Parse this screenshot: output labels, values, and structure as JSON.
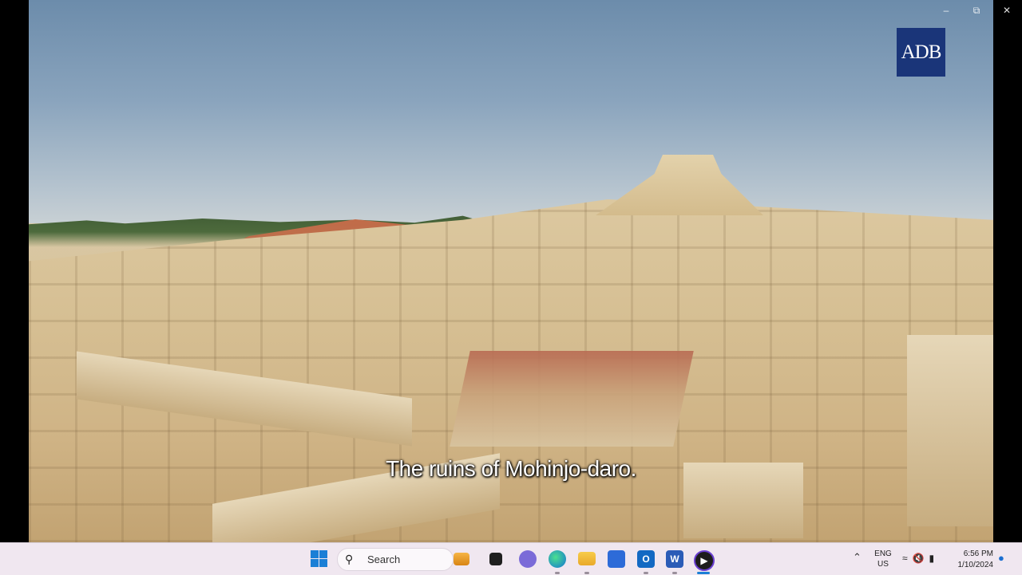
{
  "video": {
    "logo_text": "ADB",
    "caption": "The ruins of Mohinjo-daro."
  },
  "window_controls": {
    "minimize": "–",
    "restore": "⧉",
    "close": "✕"
  },
  "taskbar": {
    "search_label": "Search",
    "pinned_icons": [
      "briefcase-icon",
      "task-view-icon",
      "chat-icon",
      "edge-icon",
      "file-explorer-icon",
      "store-icon",
      "outlook-icon",
      "word-icon",
      "media-player-icon"
    ],
    "outlook_letter": "O",
    "word_letter": "W",
    "language": {
      "line1": "ENG",
      "line2": "US"
    },
    "clock": {
      "time": "6:56 PM",
      "date": "1/10/2024"
    }
  }
}
